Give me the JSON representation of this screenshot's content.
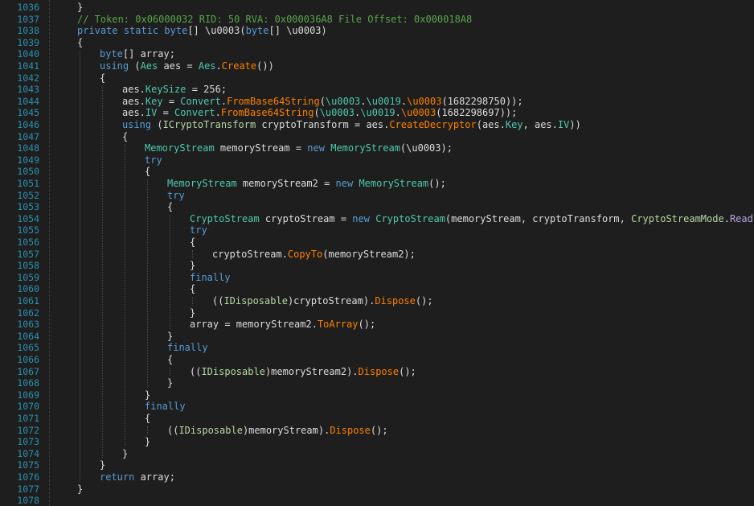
{
  "lines": [
    {
      "n": "1036",
      "ind": 1,
      "t": [
        {
          "c": "pun",
          "s": "}"
        }
      ]
    },
    {
      "n": "1037",
      "ind": 1,
      "t": [
        {
          "c": "c",
          "s": "// Token: 0x06000032 RID: 50 RVA: 0x000036A8 File Offset: 0x000018A8"
        }
      ]
    },
    {
      "n": "1038",
      "ind": 1,
      "t": [
        {
          "c": "k",
          "s": "private"
        },
        {
          "c": "pun",
          "s": " "
        },
        {
          "c": "k",
          "s": "static"
        },
        {
          "c": "pun",
          "s": " "
        },
        {
          "c": "k",
          "s": "byte"
        },
        {
          "c": "pun",
          "s": "[] "
        },
        {
          "c": "tk",
          "s": "\\u0003"
        },
        {
          "c": "pun",
          "s": "("
        },
        {
          "c": "k",
          "s": "byte"
        },
        {
          "c": "pun",
          "s": "[] "
        },
        {
          "c": "tk",
          "s": "\\u0003"
        },
        {
          "c": "pun",
          "s": ")"
        }
      ]
    },
    {
      "n": "1039",
      "ind": 1,
      "t": [
        {
          "c": "pun",
          "s": "{"
        }
      ]
    },
    {
      "n": "1040",
      "ind": 2,
      "t": [
        {
          "c": "k",
          "s": "byte"
        },
        {
          "c": "pun",
          "s": "[] array;"
        }
      ]
    },
    {
      "n": "1041",
      "ind": 2,
      "t": [
        {
          "c": "k",
          "s": "using"
        },
        {
          "c": "pun",
          "s": " ("
        },
        {
          "c": "ty",
          "s": "Aes"
        },
        {
          "c": "pun",
          "s": " aes = "
        },
        {
          "c": "ty",
          "s": "Aes"
        },
        {
          "c": "pun",
          "s": "."
        },
        {
          "c": "m",
          "s": "Create"
        },
        {
          "c": "pun",
          "s": "())"
        }
      ]
    },
    {
      "n": "1042",
      "ind": 2,
      "t": [
        {
          "c": "pun",
          "s": "{"
        }
      ]
    },
    {
      "n": "1043",
      "ind": 3,
      "t": [
        {
          "c": "pun",
          "s": "aes."
        },
        {
          "c": "p",
          "s": "KeySize"
        },
        {
          "c": "pun",
          "s": " = 256;"
        }
      ]
    },
    {
      "n": "1044",
      "ind": 3,
      "t": [
        {
          "c": "pun",
          "s": "aes."
        },
        {
          "c": "p",
          "s": "Key"
        },
        {
          "c": "pun",
          "s": " = "
        },
        {
          "c": "ty",
          "s": "Convert"
        },
        {
          "c": "pun",
          "s": "."
        },
        {
          "c": "m",
          "s": "FromBase64String"
        },
        {
          "c": "pun",
          "s": "("
        },
        {
          "c": "ty",
          "s": "\\u0003"
        },
        {
          "c": "pun",
          "s": "."
        },
        {
          "c": "ty",
          "s": "\\u0019"
        },
        {
          "c": "pun",
          "s": "."
        },
        {
          "c": "m",
          "s": "\\u0003"
        },
        {
          "c": "pun",
          "s": "(1682298750));"
        }
      ]
    },
    {
      "n": "1045",
      "ind": 3,
      "t": [
        {
          "c": "pun",
          "s": "aes."
        },
        {
          "c": "p",
          "s": "IV"
        },
        {
          "c": "pun",
          "s": " = "
        },
        {
          "c": "ty",
          "s": "Convert"
        },
        {
          "c": "pun",
          "s": "."
        },
        {
          "c": "m",
          "s": "FromBase64String"
        },
        {
          "c": "pun",
          "s": "("
        },
        {
          "c": "ty",
          "s": "\\u0003"
        },
        {
          "c": "pun",
          "s": "."
        },
        {
          "c": "ty",
          "s": "\\u0019"
        },
        {
          "c": "pun",
          "s": "."
        },
        {
          "c": "m",
          "s": "\\u0003"
        },
        {
          "c": "pun",
          "s": "(1682298697));"
        }
      ]
    },
    {
      "n": "1046",
      "ind": 3,
      "t": [
        {
          "c": "k",
          "s": "using"
        },
        {
          "c": "pun",
          "s": " ("
        },
        {
          "c": "iface",
          "s": "ICryptoTransform"
        },
        {
          "c": "pun",
          "s": " cryptoTransform = aes."
        },
        {
          "c": "m",
          "s": "CreateDecryptor"
        },
        {
          "c": "pun",
          "s": "(aes."
        },
        {
          "c": "p",
          "s": "Key"
        },
        {
          "c": "pun",
          "s": ", aes."
        },
        {
          "c": "p",
          "s": "IV"
        },
        {
          "c": "pun",
          "s": "))"
        }
      ]
    },
    {
      "n": "1047",
      "ind": 3,
      "t": [
        {
          "c": "pun",
          "s": "{"
        }
      ]
    },
    {
      "n": "1048",
      "ind": 4,
      "t": [
        {
          "c": "ty",
          "s": "MemoryStream"
        },
        {
          "c": "pun",
          "s": " memoryStream = "
        },
        {
          "c": "k",
          "s": "new"
        },
        {
          "c": "pun",
          "s": " "
        },
        {
          "c": "ty",
          "s": "MemoryStream"
        },
        {
          "c": "pun",
          "s": "(\\u0003);"
        }
      ]
    },
    {
      "n": "1049",
      "ind": 4,
      "t": [
        {
          "c": "k",
          "s": "try"
        }
      ]
    },
    {
      "n": "1050",
      "ind": 4,
      "t": [
        {
          "c": "pun",
          "s": "{"
        }
      ]
    },
    {
      "n": "1051",
      "ind": 5,
      "t": [
        {
          "c": "ty",
          "s": "MemoryStream"
        },
        {
          "c": "pun",
          "s": " memoryStream2 = "
        },
        {
          "c": "k",
          "s": "new"
        },
        {
          "c": "pun",
          "s": " "
        },
        {
          "c": "ty",
          "s": "MemoryStream"
        },
        {
          "c": "pun",
          "s": "();"
        }
      ]
    },
    {
      "n": "1052",
      "ind": 5,
      "t": [
        {
          "c": "k",
          "s": "try"
        }
      ]
    },
    {
      "n": "1053",
      "ind": 5,
      "t": [
        {
          "c": "pun",
          "s": "{"
        }
      ]
    },
    {
      "n": "1054",
      "ind": 6,
      "t": [
        {
          "c": "ty",
          "s": "CryptoStream"
        },
        {
          "c": "pun",
          "s": " cryptoStream = "
        },
        {
          "c": "k",
          "s": "new"
        },
        {
          "c": "pun",
          "s": " "
        },
        {
          "c": "ty",
          "s": "CryptoStream"
        },
        {
          "c": "pun",
          "s": "(memoryStream, cryptoTransform, "
        },
        {
          "c": "e",
          "s": "CryptoStreamMode"
        },
        {
          "c": "pun",
          "s": "."
        },
        {
          "c": "en",
          "s": "Read"
        },
        {
          "c": "pun",
          "s": ");"
        }
      ]
    },
    {
      "n": "1055",
      "ind": 6,
      "t": [
        {
          "c": "k",
          "s": "try"
        }
      ]
    },
    {
      "n": "1056",
      "ind": 6,
      "t": [
        {
          "c": "pun",
          "s": "{"
        }
      ]
    },
    {
      "n": "1057",
      "ind": 7,
      "t": [
        {
          "c": "pun",
          "s": "cryptoStream."
        },
        {
          "c": "m",
          "s": "CopyTo"
        },
        {
          "c": "pun",
          "s": "(memoryStream2);"
        }
      ]
    },
    {
      "n": "1058",
      "ind": 6,
      "t": [
        {
          "c": "pun",
          "s": "}"
        }
      ]
    },
    {
      "n": "1059",
      "ind": 6,
      "t": [
        {
          "c": "k",
          "s": "finally"
        }
      ]
    },
    {
      "n": "1060",
      "ind": 6,
      "t": [
        {
          "c": "pun",
          "s": "{"
        }
      ]
    },
    {
      "n": "1061",
      "ind": 7,
      "t": [
        {
          "c": "pun",
          "s": "(("
        },
        {
          "c": "iface",
          "s": "IDisposable"
        },
        {
          "c": "pun",
          "s": ")cryptoStream)."
        },
        {
          "c": "m",
          "s": "Dispose"
        },
        {
          "c": "pun",
          "s": "();"
        }
      ]
    },
    {
      "n": "1062",
      "ind": 6,
      "t": [
        {
          "c": "pun",
          "s": "}"
        }
      ]
    },
    {
      "n": "1063",
      "ind": 6,
      "t": [
        {
          "c": "pun",
          "s": "array = memoryStream2."
        },
        {
          "c": "m",
          "s": "ToArray"
        },
        {
          "c": "pun",
          "s": "();"
        }
      ]
    },
    {
      "n": "1064",
      "ind": 5,
      "t": [
        {
          "c": "pun",
          "s": "}"
        }
      ]
    },
    {
      "n": "1065",
      "ind": 5,
      "t": [
        {
          "c": "k",
          "s": "finally"
        }
      ]
    },
    {
      "n": "1066",
      "ind": 5,
      "t": [
        {
          "c": "pun",
          "s": "{"
        }
      ]
    },
    {
      "n": "1067",
      "ind": 6,
      "t": [
        {
          "c": "pun",
          "s": "(("
        },
        {
          "c": "iface",
          "s": "IDisposable"
        },
        {
          "c": "pun",
          "s": ")memoryStream2)."
        },
        {
          "c": "m",
          "s": "Dispose"
        },
        {
          "c": "pun",
          "s": "();"
        }
      ]
    },
    {
      "n": "1068",
      "ind": 5,
      "t": [
        {
          "c": "pun",
          "s": "}"
        }
      ]
    },
    {
      "n": "1069",
      "ind": 4,
      "t": [
        {
          "c": "pun",
          "s": "}"
        }
      ]
    },
    {
      "n": "1070",
      "ind": 4,
      "t": [
        {
          "c": "k",
          "s": "finally"
        }
      ]
    },
    {
      "n": "1071",
      "ind": 4,
      "t": [
        {
          "c": "pun",
          "s": "{"
        }
      ]
    },
    {
      "n": "1072",
      "ind": 5,
      "t": [
        {
          "c": "pun",
          "s": "(("
        },
        {
          "c": "iface",
          "s": "IDisposable"
        },
        {
          "c": "pun",
          "s": ")memoryStream)."
        },
        {
          "c": "m",
          "s": "Dispose"
        },
        {
          "c": "pun",
          "s": "();"
        }
      ]
    },
    {
      "n": "1073",
      "ind": 4,
      "t": [
        {
          "c": "pun",
          "s": "}"
        }
      ]
    },
    {
      "n": "1074",
      "ind": 3,
      "t": [
        {
          "c": "pun",
          "s": "}"
        }
      ]
    },
    {
      "n": "1075",
      "ind": 2,
      "t": [
        {
          "c": "pun",
          "s": "}"
        }
      ]
    },
    {
      "n": "1076",
      "ind": 2,
      "t": [
        {
          "c": "k",
          "s": "return"
        },
        {
          "c": "pun",
          "s": " array;"
        }
      ]
    },
    {
      "n": "1077",
      "ind": 1,
      "t": [
        {
          "c": "pun",
          "s": "}"
        }
      ]
    },
    {
      "n": "1078",
      "ind": 0,
      "t": []
    }
  ]
}
